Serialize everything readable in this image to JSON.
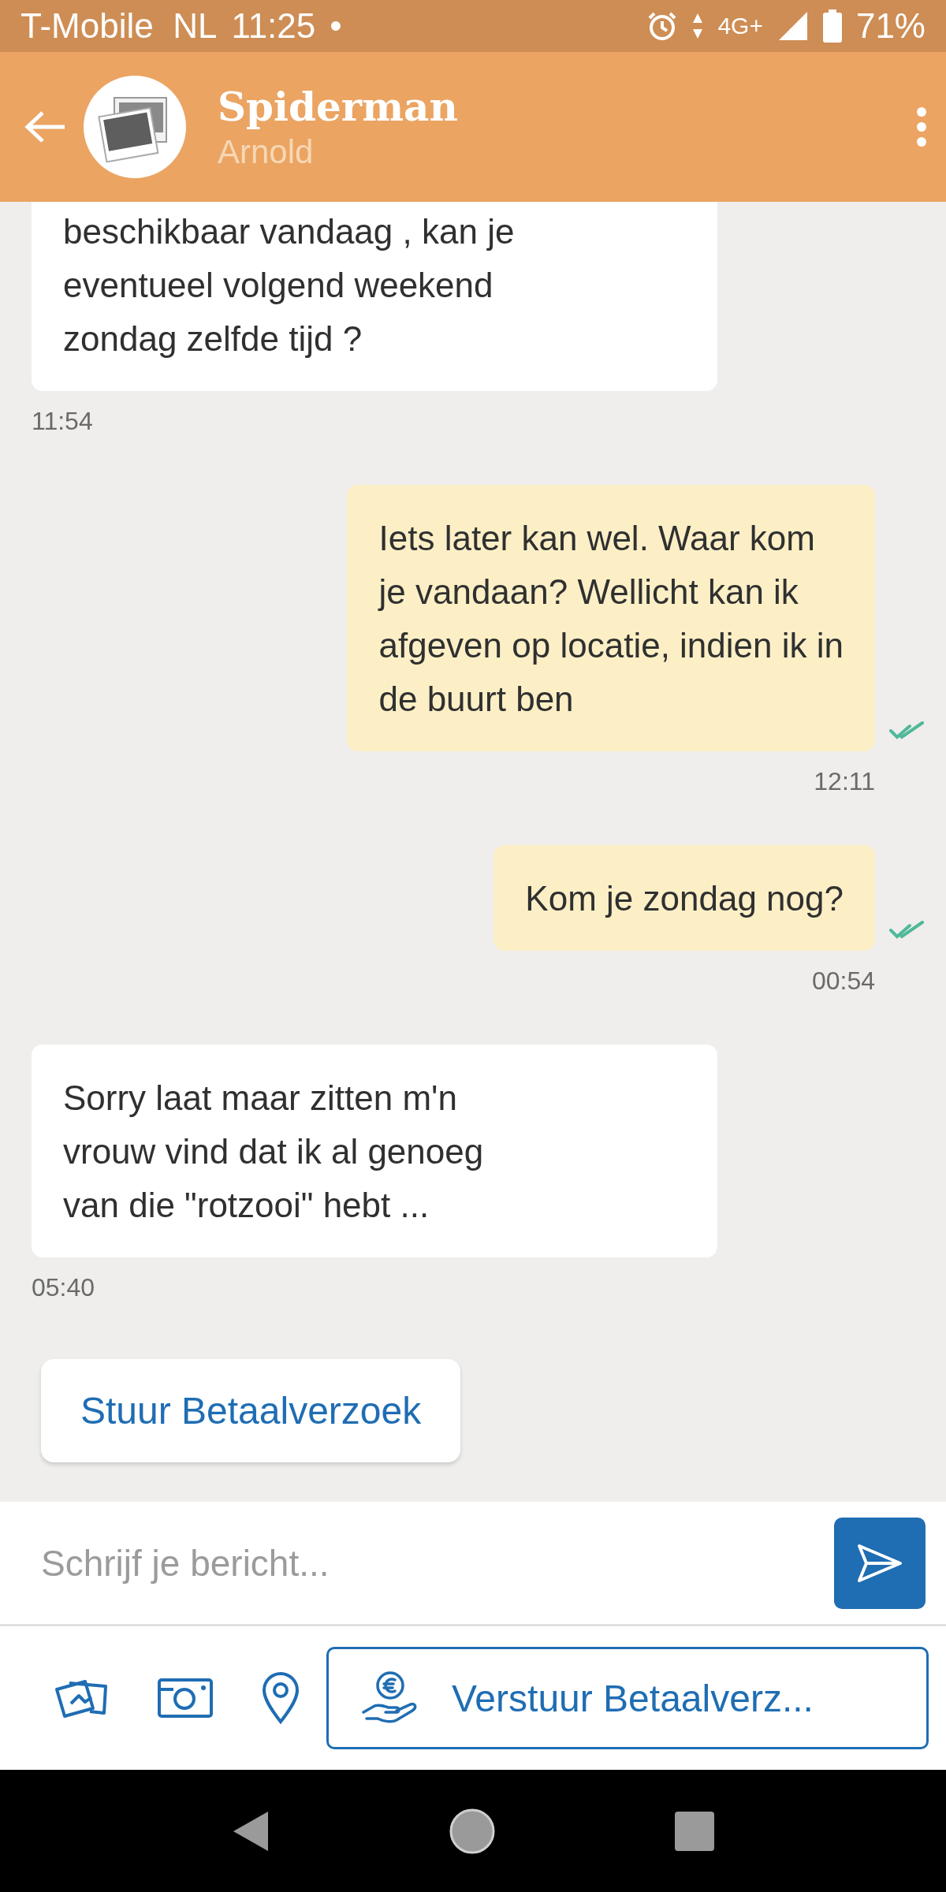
{
  "status_bar": {
    "carrier": "T-Mobile  NL",
    "time": "11:25",
    "dot": "•",
    "network": "4G+",
    "battery": "71%"
  },
  "header": {
    "title": "Spiderman",
    "subtitle": "Arnold"
  },
  "messages": [
    {
      "kind": "incoming",
      "text": "beschikbaar vandaag , kan je\neventueel volgend weekend\nzondag zelfde tijd ?",
      "time": "11:54",
      "cut_top": true
    },
    {
      "kind": "outgoing",
      "text": "Iets later kan wel. Waar kom\nje vandaan? Wellicht kan ik\nafgeven op locatie, indien ik in\nde buurt ben",
      "time": "12:11",
      "read": true
    },
    {
      "kind": "outgoing",
      "text": "Kom je zondag nog?",
      "time": "00:54",
      "read": true
    },
    {
      "kind": "incoming",
      "text": "Sorry laat maar zitten m'n\nvrouw vind dat ik al genoeg\nvan die \"rotzooi\" hebt ...",
      "time": "05:40",
      "cut_top": false
    }
  ],
  "quick_action": "Stuur Betaalverzoek",
  "composer": {
    "placeholder": "Schrijf je bericht..."
  },
  "toolbar": {
    "payment_button": "Verstuur Betaalverz..."
  }
}
